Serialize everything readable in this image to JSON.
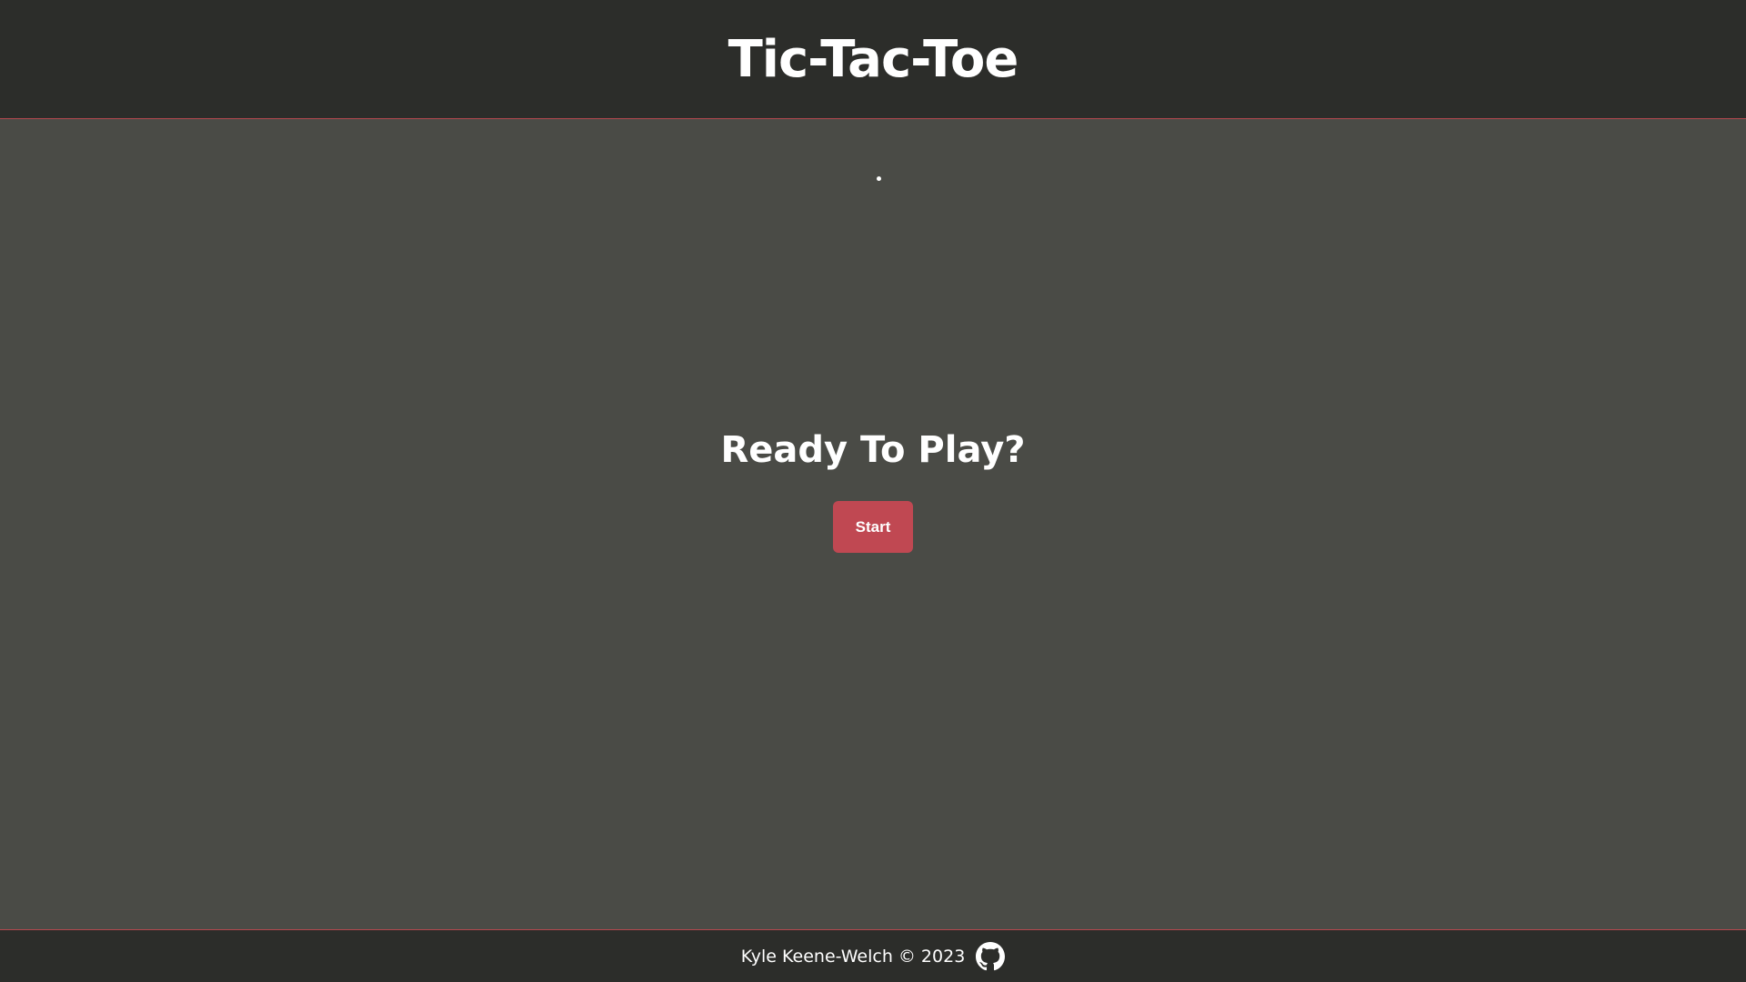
{
  "header": {
    "title": "Tic-Tac-Toe"
  },
  "main": {
    "prompt": "Ready To Play?",
    "start_label": "Start"
  },
  "footer": {
    "credit": "Kyle Keene-Welch © 2023",
    "icon": "github-icon"
  },
  "colors": {
    "header_bg": "#2c2d2a",
    "main_bg": "#4a4b46",
    "accent": "#c04852",
    "border": "#b5484f",
    "text": "#ffffff"
  }
}
